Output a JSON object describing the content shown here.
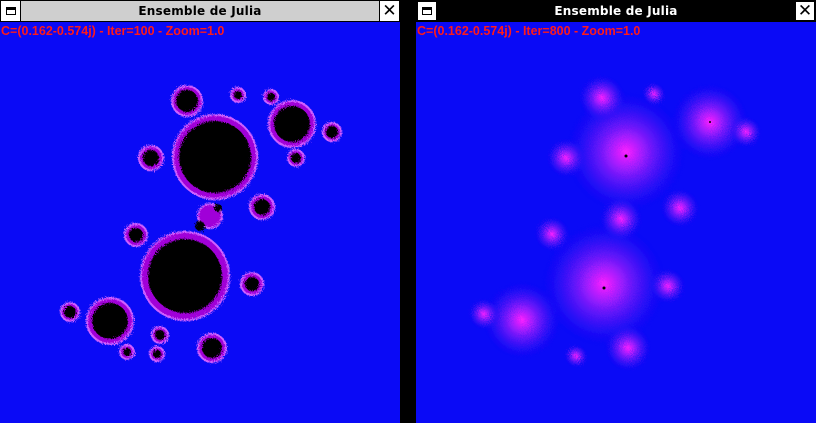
{
  "windows": [
    {
      "title": "Ensemble de Julia",
      "info": "C=(0.162-0.574j) - Iter=100 - Zoom=1.0",
      "active": false,
      "icons": {
        "system_menu": "window-menu-icon",
        "close": "close-icon"
      }
    },
    {
      "title": "Ensemble de Julia",
      "info": "C=(0.162-0.574j) - Iter=800 - Zoom=1.0",
      "active": true,
      "icons": {
        "system_menu": "window-menu-icon",
        "close": "close-icon"
      }
    }
  ],
  "colors": {
    "background": "#0a0af6",
    "info_text": "#ff1a1a",
    "fractal_fill": "#000000",
    "fractal_edge": "#b000e0",
    "inactive_titlebar": "#cfcfcf",
    "active_titlebar": "#000000",
    "divider": "#000000"
  }
}
